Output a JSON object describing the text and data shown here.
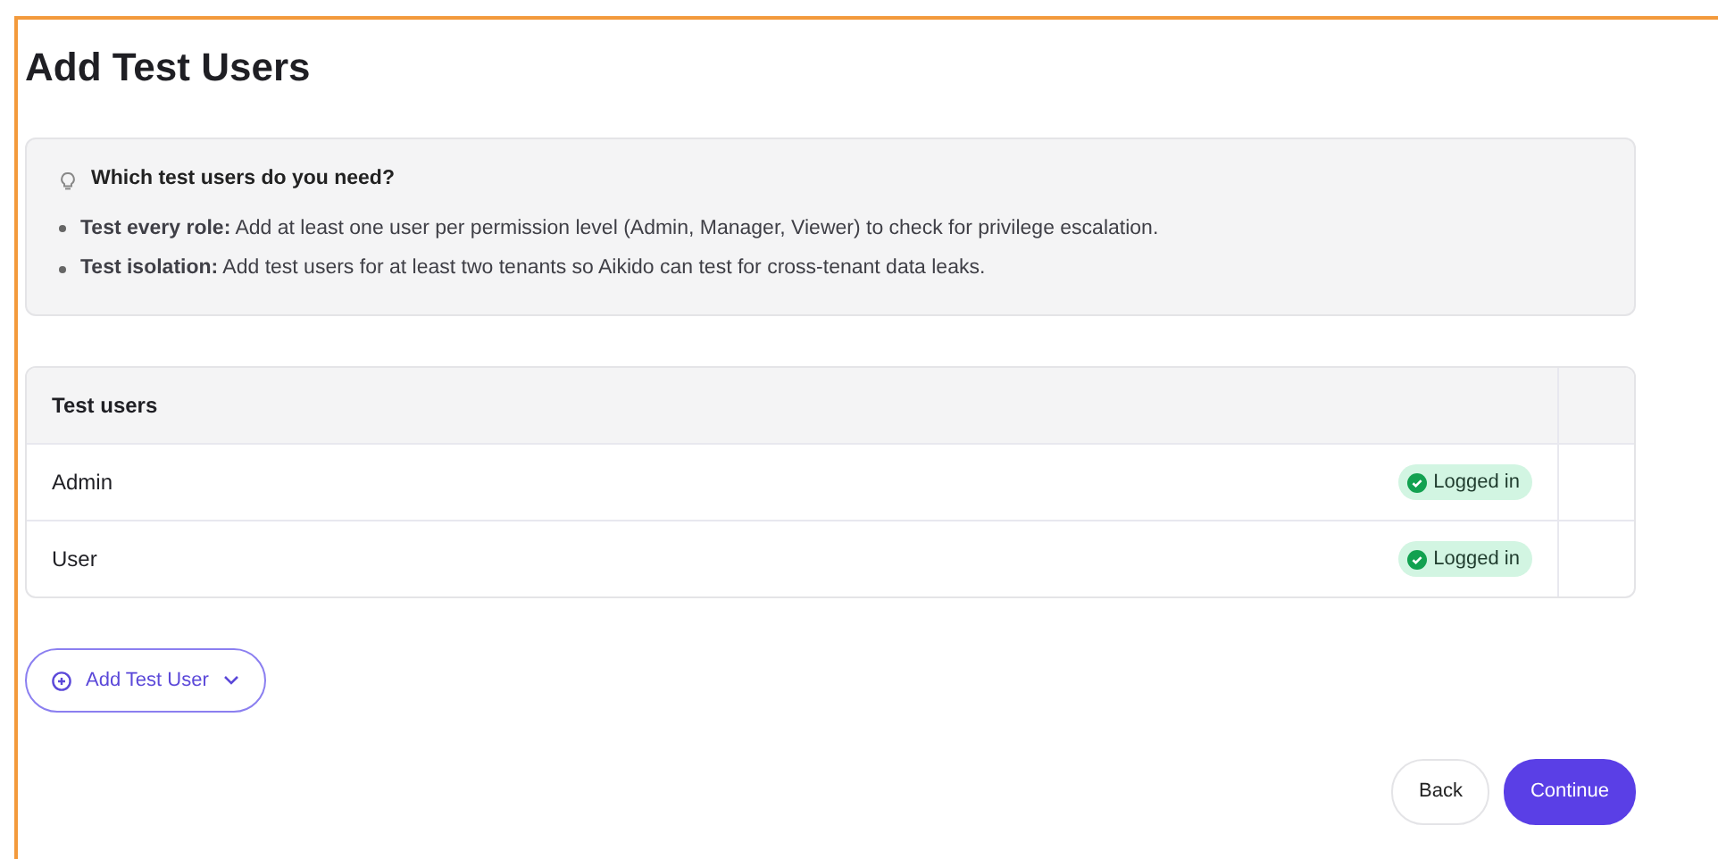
{
  "title": "Add Test Users",
  "tip": {
    "heading": "Which test users do you need?",
    "items": [
      "**Test every role:** Add at least one user per permission level (Admin, Manager, Viewer) to check for privilege escalation.",
      "**Test isolation:** Add test users for at least two tenants so Aikido can test for cross-tenant data leaks."
    ]
  },
  "table": {
    "columns": [
      "Test users"
    ],
    "rows": [
      {
        "name": "Admin",
        "status": {
          "label": "Logged in",
          "kind": "success"
        }
      },
      {
        "name": "User",
        "status": {
          "label": "Logged in",
          "kind": "success"
        }
      }
    ]
  },
  "add_button": {
    "label": "Add Test User"
  },
  "buttons": [
    {
      "label": "Back",
      "kind": "secondary"
    },
    {
      "label": "Continue",
      "kind": "primary"
    }
  ]
}
